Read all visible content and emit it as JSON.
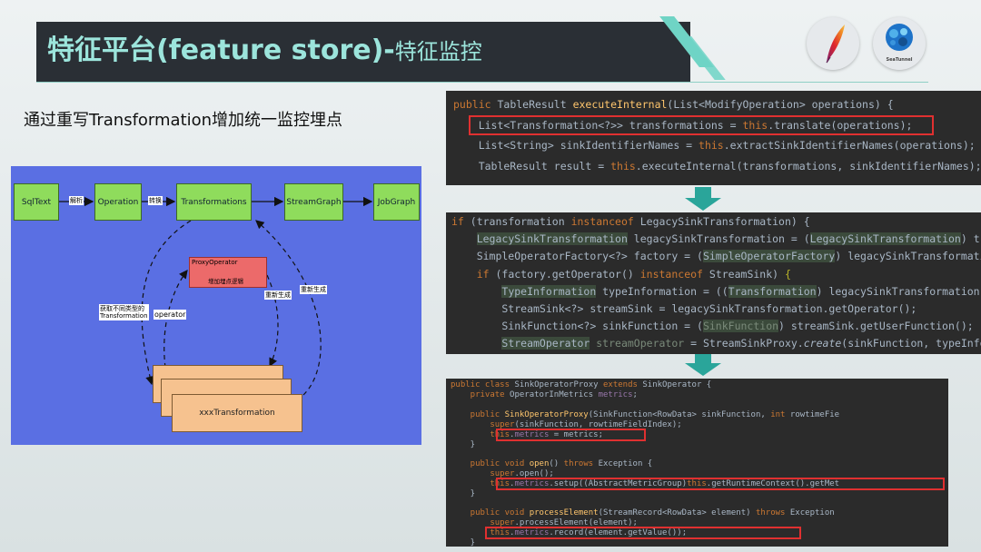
{
  "header": {
    "title_main": "特征平台(feature store)-",
    "title_sub": "特征监控"
  },
  "logos": {
    "logo1_icon": "apache-feather-icon",
    "logo2_icon": "seatunnel-icon",
    "logo2_text": "SeaTunnel"
  },
  "subtitle": "通过重写Transformation增加统一监控埋点",
  "diagram": {
    "nodes": [
      "SqlText",
      "Operation",
      "Transformations",
      "StreamGraph",
      "JobGraph"
    ],
    "edge_labels": [
      "解析",
      "转换"
    ],
    "proxy_title": "ProxyOperator",
    "proxy_subtitle": "增加埋点逻辑",
    "left_label_line1": "获取不同类型的",
    "left_label_line2": "Transformation",
    "operator_label": "operator",
    "regen1": "重新生成",
    "regen2": "重新生成",
    "card_label": "xxxTransformation"
  },
  "code1": {
    "lines": [
      "public TableResult executeInternal(List<ModifyOperation> operations) {",
      "    List<Transformation<?>> transformations = this.translate(operations);",
      "    List<String> sinkIdentifierNames = this.extractSinkIdentifierNames(operations);",
      "    TableResult result = this.executeInternal(transformations, sinkIdentifierNames);"
    ]
  },
  "code2": {
    "lines": [
      "if (transformation instanceof LegacySinkTransformation) {",
      "    LegacySinkTransformation legacySinkTransformation = (LegacySinkTransformation) transf",
      "    SimpleOperatorFactory<?> factory = (SimpleOperatorFactory) legacySinkTransformation.g",
      "    if (factory.getOperator() instanceof StreamSink) {",
      "        TypeInformation typeInformation = ((Transformation) legacySinkTransformation.getI",
      "        StreamSink<?> streamSink = legacySinkTransformation.getOperator();",
      "        SinkFunction<?> sinkFunction = (SinkFunction) streamSink.getUserFunction();",
      "        StreamOperator streamOperator = StreamSinkProxy.create(sinkFunction, typeInforma"
    ]
  },
  "code3": {
    "lines": [
      "public class SinkOperatorProxy extends SinkOperator {",
      "    private OperatorInMetrics metrics;",
      "",
      "    public SinkOperatorProxy(SinkFunction<RowData> sinkFunction, int rowtimeFie",
      "        super(sinkFunction, rowtimeFieldIndex);",
      "        this.metrics = metrics;",
      "    }",
      "",
      "    public void open() throws Exception {",
      "        super.open();",
      "        this.metrics.setup((AbstractMetricGroup)this.getRuntimeContext().getMet",
      "    }",
      "",
      "    public void processElement(StreamRecord<RowData> element) throws Exception",
      "        super.processElement(element);",
      "        this.metrics.record(element.getValue());",
      "    }"
    ]
  }
}
